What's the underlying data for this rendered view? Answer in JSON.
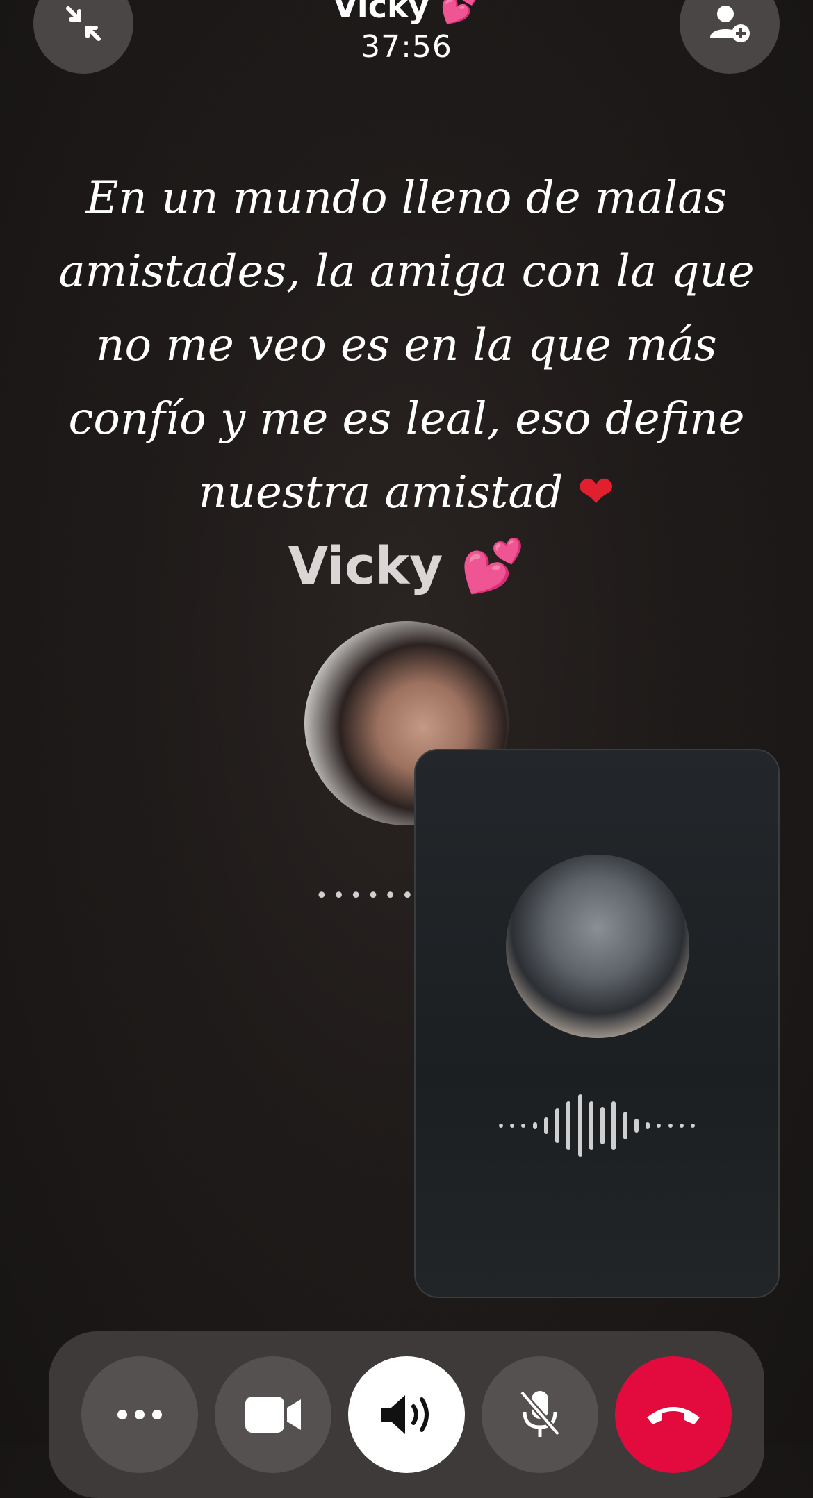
{
  "header": {
    "title": "Vicky 💕",
    "timer": "37:56"
  },
  "quote": {
    "line1": "En un mundo lleno de malas",
    "line2": "amistades, la amiga con la que",
    "line3": "no me veo es en la que más",
    "line4": "confío y me es leal, eso define",
    "line5": "nuestra amistad",
    "heart": "❤"
  },
  "caller": {
    "name": "Vicky",
    "emoji": "💕"
  },
  "status": {
    "connecting_dots": "••••••••"
  },
  "icons": {
    "minimize": "minimize-arrows-icon",
    "add_person": "add-person-icon",
    "more": "more-dots-icon",
    "video": "video-camera-icon",
    "speaker": "speaker-icon",
    "mute": "mic-off-icon",
    "end": "end-call-icon"
  },
  "colors": {
    "end_call": "#e30b3d",
    "background": "#1f1b1a"
  }
}
